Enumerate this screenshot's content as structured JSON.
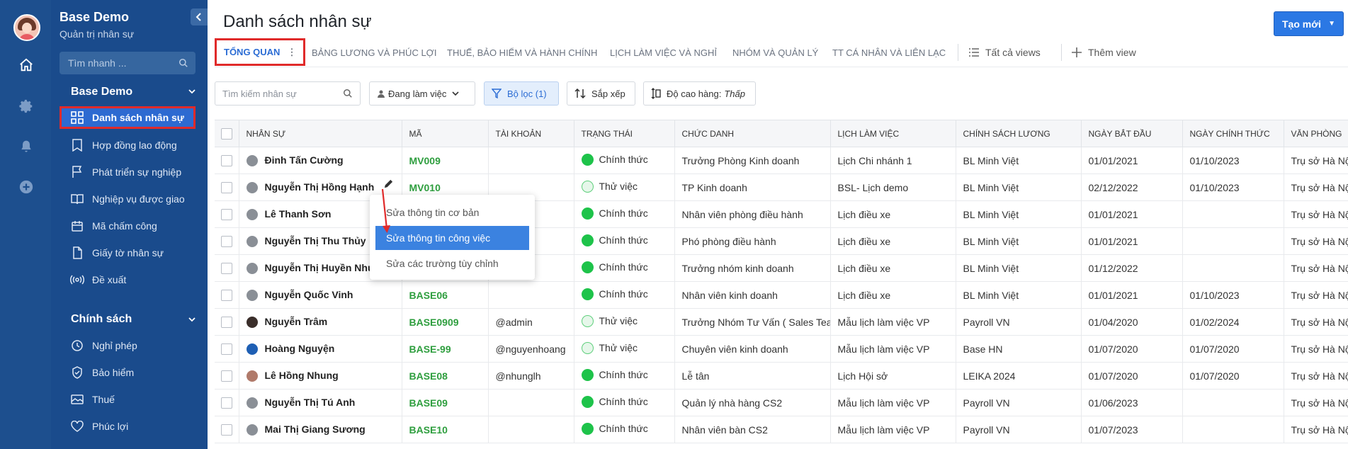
{
  "app": {
    "brand_title": "Base Demo",
    "brand_subtitle": "Quản trị nhân sự",
    "search_placeholder": "Tìm nhanh ..."
  },
  "sidebar": {
    "group1_title": "Base Demo",
    "group1_items": [
      {
        "label": "Danh sách nhân sự",
        "icon": "grid-icon"
      },
      {
        "label": "Hợp đồng lao động",
        "icon": "bookmark-icon"
      },
      {
        "label": "Phát triển sự nghiệp",
        "icon": "flag-icon"
      },
      {
        "label": "Nghiệp vụ được giao",
        "icon": "book-icon"
      },
      {
        "label": "Mã chấm công",
        "icon": "calendar-icon"
      },
      {
        "label": "Giấy tờ nhân sự",
        "icon": "document-icon"
      },
      {
        "label": "Đề xuất",
        "icon": "broadcast-icon"
      }
    ],
    "group2_title": "Chính sách",
    "group2_items": [
      {
        "label": "Nghỉ phép",
        "icon": "clock-icon"
      },
      {
        "label": "Bảo hiểm",
        "icon": "shield-icon"
      },
      {
        "label": "Thuế",
        "icon": "image-icon"
      },
      {
        "label": "Phúc lợi",
        "icon": "heart-icon"
      }
    ]
  },
  "header": {
    "title": "Danh sách nhân sự",
    "create_label": "Tạo mới"
  },
  "tabs": [
    "TỔNG QUAN",
    "BẢNG LƯƠNG VÀ PHÚC LỢI",
    "THUẾ, BẢO HIỂM VÀ HÀNH CHÍNH",
    "LỊCH LÀM VIỆC VÀ NGHỈ",
    "NHÓM VÀ QUẢN LÝ",
    "TT CÁ NHÂN VÀ LIÊN LẠC"
  ],
  "views": {
    "all_views": "Tất cả views",
    "add_view": "Thêm view"
  },
  "toolbar": {
    "search_placeholder": "Tìm kiếm nhân sự",
    "status_filter": "Đang làm việc",
    "filter_label": "Bộ lọc (1)",
    "sort_label": "Sắp xếp",
    "row_height_label": "Độ cao hàng:",
    "row_height_value": "Thấp"
  },
  "table": {
    "columns": [
      "NHÂN SỰ",
      "MÃ",
      "TÀI KHOẢN",
      "TRẠNG THÁI",
      "CHỨC DANH",
      "LỊCH LÀM VIỆC",
      "CHÍNH SÁCH LƯƠNG",
      "NGÀY BẮT ĐẦU",
      "NGÀY CHÍNH THỨC",
      "VĂN PHÒNG"
    ],
    "rows": [
      {
        "name": "Đinh Tấn Cường",
        "code": "MV009",
        "account": "",
        "status": "Chính thức",
        "status_type": "on",
        "title": "Trưởng Phòng Kinh doanh",
        "schedule": "Lịch Chi nhánh 1",
        "salary": "BL Minh Việt",
        "start": "01/01/2021",
        "official": "01/10/2023",
        "office": "Trụ sở Hà Nội"
      },
      {
        "name": "Nguyễn Thị Hồng Hạnh",
        "code": "MV010",
        "account": "",
        "status": "Thử việc",
        "status_type": "trial",
        "title": "TP Kinh doanh",
        "schedule": "BSL- Lịch demo",
        "salary": "BL Minh Việt",
        "start": "02/12/2022",
        "official": "01/10/2023",
        "office": "Trụ sở Hà Nội"
      },
      {
        "name": "Lê Thanh Sơn",
        "code": "",
        "account": "",
        "status": "Chính thức",
        "status_type": "on",
        "title": "Nhân viên phòng điều hành",
        "schedule": "Lịch điều xe",
        "salary": "BL Minh Việt",
        "start": "01/01/2021",
        "official": "",
        "office": "Trụ sở Hà Nội"
      },
      {
        "name": "Nguyễn Thị Thu Thủy",
        "code": "",
        "account": "",
        "status": "Chính thức",
        "status_type": "on",
        "title": "Phó phòng điều hành",
        "schedule": "Lịch điều xe",
        "salary": "BL Minh Việt",
        "start": "01/01/2021",
        "official": "",
        "office": "Trụ sở Hà Nội"
      },
      {
        "name": "Nguyễn Thị Huyền Nhung",
        "code": "",
        "account": "",
        "status": "Chính thức",
        "status_type": "on",
        "title": "Trưởng nhóm kinh doanh",
        "schedule": "Lịch điều xe",
        "salary": "BL Minh Việt",
        "start": "01/12/2022",
        "official": "",
        "office": "Trụ sở Hà Nội"
      },
      {
        "name": "Nguyễn Quốc Vinh",
        "code": "BASE06",
        "account": "",
        "status": "Chính thức",
        "status_type": "on",
        "title": "Nhân viên kinh doanh",
        "schedule": "Lịch điều xe",
        "salary": "BL Minh Việt",
        "start": "01/01/2021",
        "official": "01/10/2023",
        "office": "Trụ sở Hà Nội"
      },
      {
        "name": "Nguyễn Trâm",
        "code": "BASE0909",
        "account": "@admin",
        "status": "Thử việc",
        "status_type": "trial",
        "title": "Trưởng Nhóm Tư Vấn ( Sales Team Leader )",
        "schedule": "Mẫu lịch làm việc VP",
        "salary": "Payroll VN",
        "start": "01/04/2020",
        "official": "01/02/2024",
        "office": "Trụ sở Hà Nội"
      },
      {
        "name": "Hoàng Nguyện",
        "code": "BASE-99",
        "account": "@nguyenhoang",
        "status": "Thử việc",
        "status_type": "trial",
        "title": "Chuyên viên kinh doanh",
        "schedule": "Mẫu lịch làm việc VP",
        "salary": "Base HN",
        "start": "01/07/2020",
        "official": "01/07/2020",
        "office": "Trụ sở Hà Nội"
      },
      {
        "name": "Lê Hồng Nhung",
        "code": "BASE08",
        "account": "@nhunglh",
        "status": "Chính thức",
        "status_type": "on",
        "title": "Lễ tân",
        "schedule": "Lịch Hội sở",
        "salary": "LEIKA 2024",
        "start": "01/07/2020",
        "official": "01/07/2020",
        "office": "Trụ sở Hà Nội"
      },
      {
        "name": "Nguyễn Thị Tú Anh",
        "code": "BASE09",
        "account": "",
        "status": "Chính thức",
        "status_type": "on",
        "title": "Quản lý nhà hàng CS2",
        "schedule": "Mẫu lịch làm việc VP",
        "salary": "Payroll VN",
        "start": "01/06/2023",
        "official": "",
        "office": "Trụ sở Hà Nội"
      },
      {
        "name": "Mai Thị Giang Sương",
        "code": "BASE10",
        "account": "",
        "status": "Chính thức",
        "status_type": "on",
        "title": "Nhân viên bàn CS2",
        "schedule": "Mẫu lịch làm việc VP",
        "salary": "Payroll VN",
        "start": "01/07/2023",
        "official": "",
        "office": "Trụ sở Hà Nội"
      }
    ]
  },
  "context_menu": [
    "Sửa thông tin cơ bản",
    "Sửa thông tin công việc",
    "Sửa các trường tùy chỉnh"
  ],
  "colors": {
    "sidebar_bg": "#1a4b8c",
    "accent": "#2b78e4",
    "code_green": "#2e9e3e",
    "status_green": "#1ec34a",
    "highlight_red": "#e02a2a"
  }
}
